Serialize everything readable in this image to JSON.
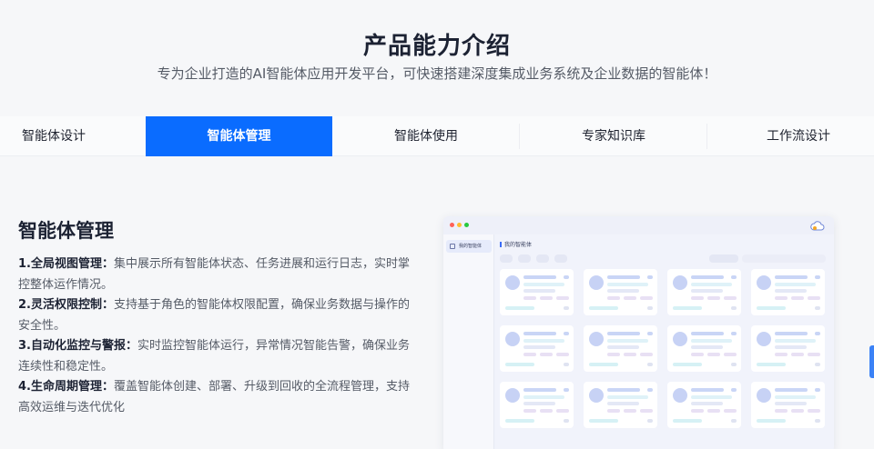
{
  "header": {
    "title": "产品能力介绍",
    "subtitle": "专为企业打造的AI智能体应用开发平台，可快速搭建深度集成业务系统及企业数据的智能体！"
  },
  "tabs": [
    {
      "label": "智能体设计",
      "active": false
    },
    {
      "label": "智能体管理",
      "active": true
    },
    {
      "label": "智能体使用",
      "active": false
    },
    {
      "label": "专家知识库",
      "active": false
    },
    {
      "label": "工作流设计",
      "active": false
    }
  ],
  "section": {
    "title": "智能体管理",
    "features": [
      {
        "head": "1.全局视图管理：",
        "text": "集中展示所有智能体状态、任务进展和运行日志，实时掌控整体运作情况。"
      },
      {
        "head": "2.灵活权限控制：",
        "text": "支持基于角色的智能体权限配置，确保业务数据与操作的安全性。"
      },
      {
        "head": "3.自动化监控与警报：",
        "text": "实时监控智能体运行，异常情况智能告警，确保业务连续性和稳定性。"
      },
      {
        "head": "4.生命周期管理：",
        "text": "覆盖智能体创建、部署、升级到回收的全流程管理，支持高效运维与迭代优化"
      }
    ]
  },
  "mock": {
    "side_item": "我的智能体",
    "main_title": "我的智能体",
    "cards": 12
  },
  "colors": {
    "accent": "#0a6cff",
    "title": "#1c2233",
    "body_text": "#555b66"
  }
}
